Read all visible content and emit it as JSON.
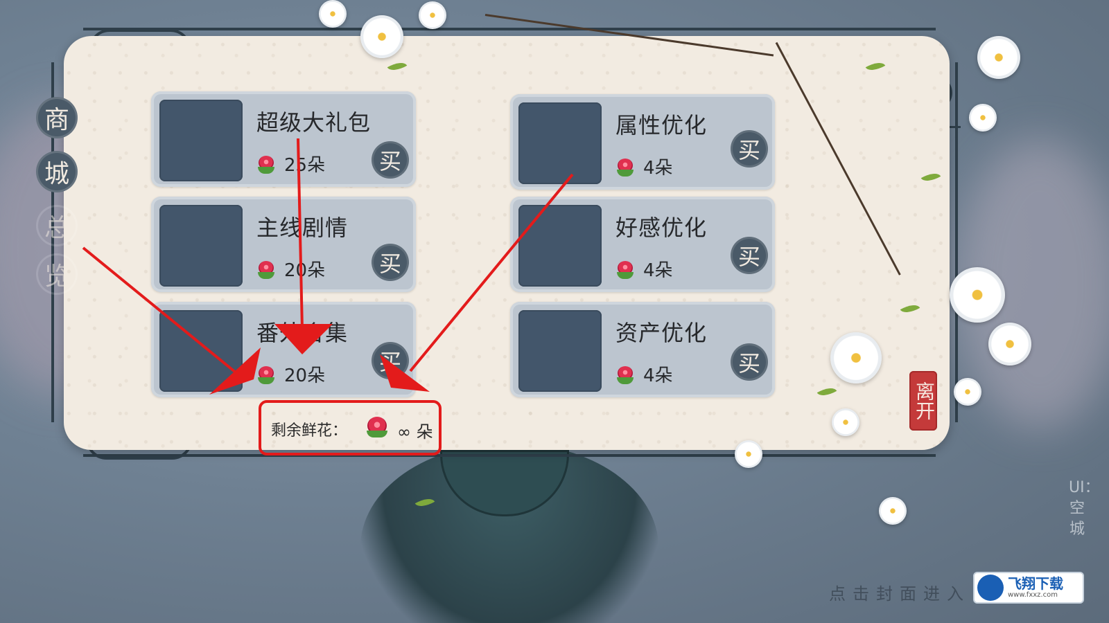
{
  "sidebar": {
    "title_chars": [
      "商",
      "城",
      "总",
      "览"
    ]
  },
  "shop": {
    "items": [
      {
        "name": "超级大礼包",
        "price": "25朵",
        "buy_label": "买"
      },
      {
        "name": "属性优化",
        "price": "4朵",
        "buy_label": "买"
      },
      {
        "name": "主线剧情",
        "price": "20朵",
        "buy_label": "买"
      },
      {
        "name": "好感优化",
        "price": "4朵",
        "buy_label": "买"
      },
      {
        "name": "番外合集",
        "price": "20朵",
        "buy_label": "买"
      },
      {
        "name": "资产优化",
        "price": "4朵",
        "buy_label": "买"
      }
    ],
    "remaining_label": "剩余鲜花：",
    "remaining_value": "∞ 朵"
  },
  "leave_label": "离开",
  "hint_text": "点击封面进入",
  "credit_text": "UI：空城",
  "watermark": {
    "name": "飞翔下载",
    "url": "www.fxxz.com"
  },
  "colors": {
    "card": "#f2ebe1",
    "item": "#bcc5cf",
    "button": "#4a5a68",
    "highlight": "#e31b1b",
    "seal": "#c43a3a"
  },
  "icons": [
    "rose-icon",
    "buy-seal-icon",
    "leave-seal-icon",
    "arrow-annotation"
  ]
}
